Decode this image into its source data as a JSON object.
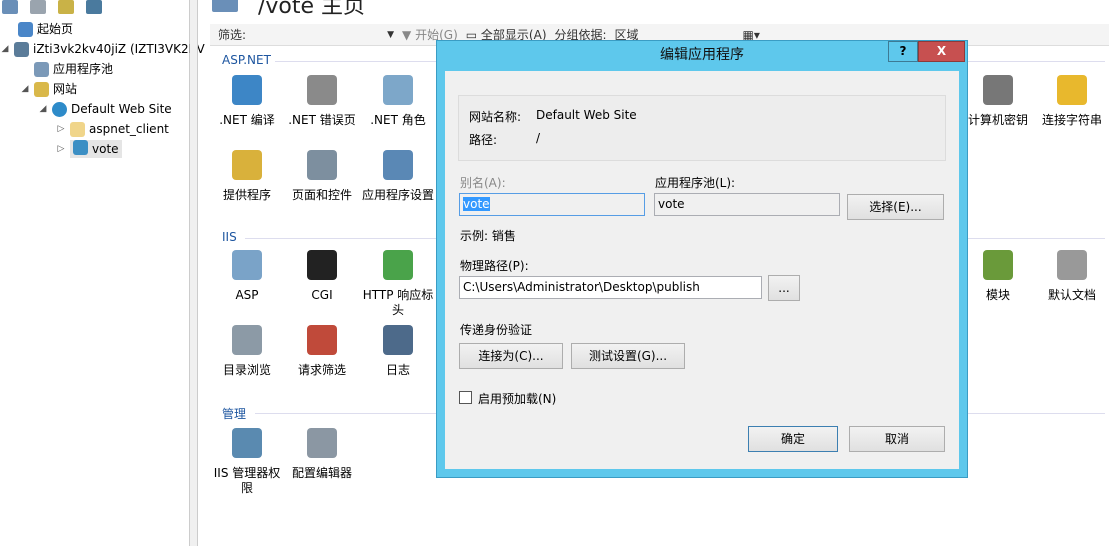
{
  "toolbar_left": {
    "icons": [
      "connect-icon",
      "save-icon",
      "folder-up-icon",
      "disconnect-icon"
    ]
  },
  "tree": [
    {
      "label": "起始页",
      "toggle": ""
    },
    {
      "label": "iZti3vk2kv40jiZ (IZTI3VK2KV",
      "toggle": "◢"
    },
    {
      "label": "应用程序池",
      "toggle": ""
    },
    {
      "label": "网站",
      "toggle": "◢"
    },
    {
      "label": "Default Web Site",
      "toggle": "◢"
    },
    {
      "label": "aspnet_client",
      "toggle": "▷"
    },
    {
      "label": "vote",
      "toggle": "▷"
    }
  ],
  "main": {
    "title": "/vote 主页",
    "toolbar": {
      "filter_label": "筛选:",
      "start": "开始(G)",
      "show_all": "全部显示(A)",
      "group_by": "分组依据:",
      "group_value": "区域"
    },
    "sections": {
      "aspnet": "ASP.NET",
      "iis": "IIS",
      "manage": "管理"
    },
    "features": [
      ".NET 编译",
      ".NET 错误页",
      ".NET 角色",
      "提供程序",
      "页面和控件",
      "应用程序设置",
      "ASP",
      "CGI",
      "HTTP 响应标头",
      "目录浏览",
      "请求筛选",
      "日志",
      "IIS 管理器权限",
      "配置编辑器",
      "计算机密钥",
      "连接字符串",
      "模块",
      "默认文档"
    ]
  },
  "dialog": {
    "title": "编辑应用程序",
    "help": "?",
    "close": "X",
    "site_name_label": "网站名称:",
    "site_name": "Default Web Site",
    "path_label": "路径:",
    "path": "/",
    "alias_label": "别名(A):",
    "alias": "vote",
    "pool_label": "应用程序池(L):",
    "pool": "vote",
    "select_btn": "选择(E)...",
    "example": "示例: 销售",
    "phys_label": "物理路径(P):",
    "phys": "C:\\Users\\Administrator\\Desktop\\publish",
    "browse_btn": "...",
    "auth_label": "传递身份验证",
    "connect_as": "连接为(C)...",
    "test_settings": "测试设置(G)...",
    "preload": "启用预加载(N)",
    "preload_checked": false,
    "ok": "确定",
    "cancel": "取消"
  },
  "colors": {
    "dialog_frame": "#5ec8ec",
    "close": "#c75050",
    "section": "#1e56a0"
  }
}
